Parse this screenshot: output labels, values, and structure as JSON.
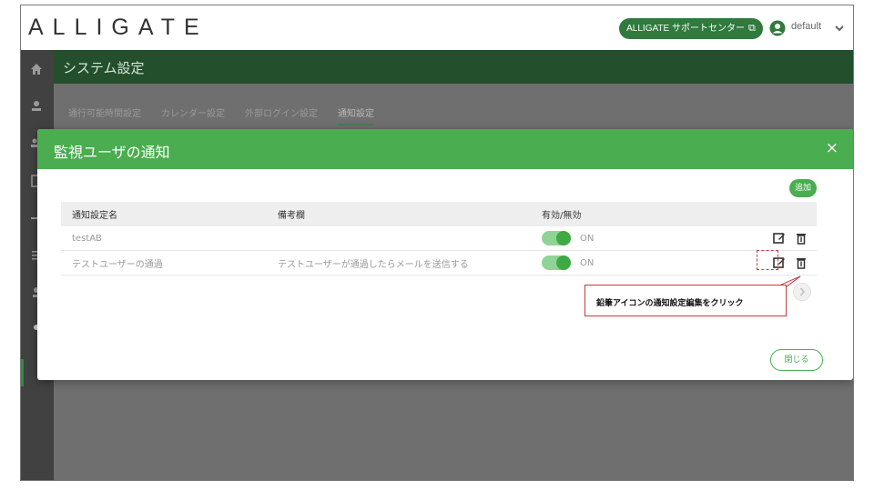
{
  "app": {
    "logo": "ALLIGATE",
    "support_button": "ALLIGATE サポートセンター",
    "user_name": "default"
  },
  "page": {
    "title": "システム設定",
    "tabs": [
      {
        "label": "通行可能時間設定",
        "active": false
      },
      {
        "label": "カレンダー設定",
        "active": false
      },
      {
        "label": "外部ログイン設定",
        "active": false
      },
      {
        "label": "通知設定",
        "active": true
      }
    ]
  },
  "modal": {
    "title": "監視ユーザの通知",
    "close_icon": "×",
    "add_button": "追加",
    "columns": [
      "通知設定名",
      "備考欄",
      "有効/無効"
    ],
    "rows": [
      {
        "name": "testAB",
        "note": "",
        "status": "ON",
        "enabled": true
      },
      {
        "name": "テストユーザーの通過",
        "note": "テストユーザーが通過したらメールを送信する",
        "status": "ON",
        "enabled": true
      }
    ],
    "close_button": "閉じる"
  },
  "annotation": {
    "text": "鉛筆アイコンの通知設定編集をクリック",
    "color": "#c43c3c"
  },
  "colors": {
    "accent": "#4aad4f",
    "header_dark": "#234f2c",
    "support": "#2f7a3c"
  }
}
